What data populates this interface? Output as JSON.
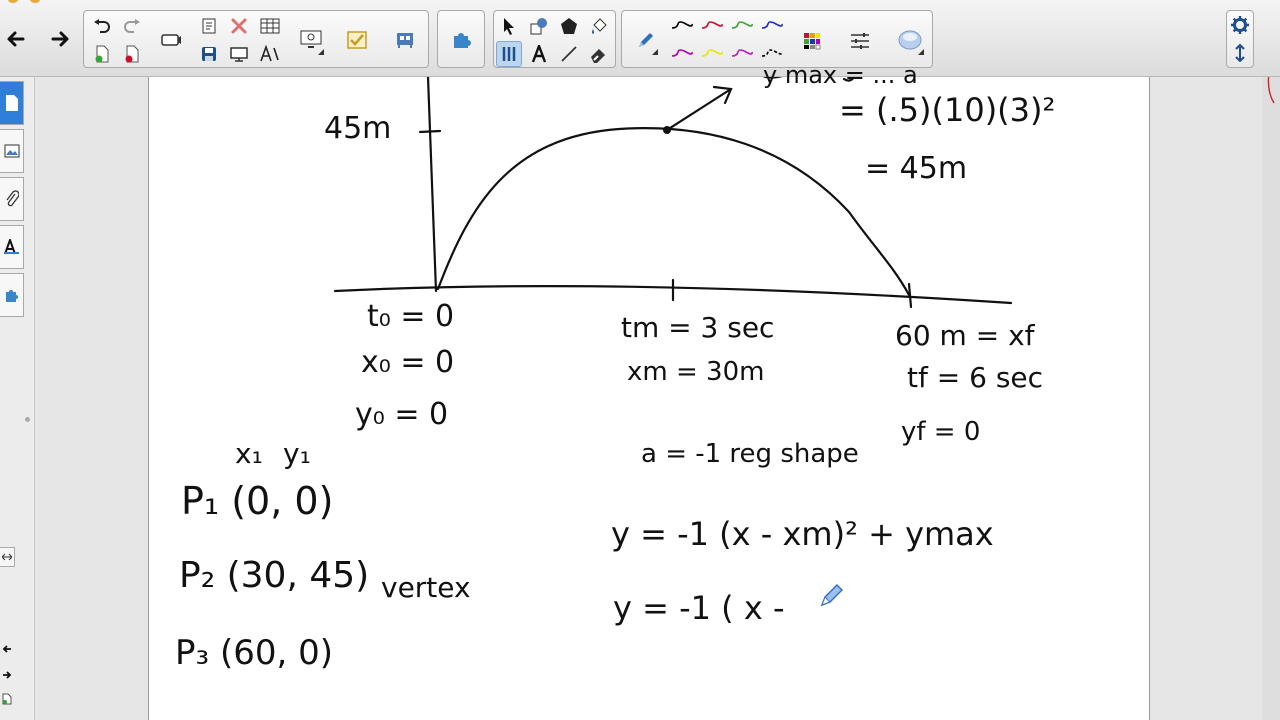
{
  "toolbar": {
    "groups": [
      "navigation",
      "edit",
      "display",
      "tools",
      "gallery",
      "select",
      "pens",
      "properties",
      "settings"
    ],
    "pen_colors": [
      "#000000",
      "#c8102e",
      "#3aa335",
      "#1f2fbf",
      "#b100b1",
      "#e8e800",
      "#000000"
    ],
    "accent_color": "#2f7fd8"
  },
  "sidebar": {
    "items": [
      "page-sorter",
      "gallery",
      "attachments",
      "properties",
      "add-ons"
    ]
  },
  "board": {
    "graph": {
      "label_45m": "45m",
      "t0": "t₀ = 0",
      "x0": "x₀ = 0",
      "y0": "y₀ = 0",
      "tm": "tm = 3 sec",
      "xm": "xm = 30m",
      "xf": "60 m = xf",
      "tf": "tf = 6 sec",
      "yf": "yf = 0"
    },
    "calc": {
      "top": "y max = ... a",
      "line1": "= (.5)(10)(3)²",
      "line2": "= 45m"
    },
    "points": {
      "header_x": "x₁",
      "header_y": "y₁",
      "p1": "P₁ (0, 0)",
      "p2": "P₂ (30, 45)",
      "p2_note": "vertex",
      "p3": "P₃ (60, 0)"
    },
    "equations": {
      "shape": "a = -1 reg shape",
      "eq1": "y = -1 (x - xm)² + ymax",
      "eq2": "y = -1 ( x -"
    }
  }
}
